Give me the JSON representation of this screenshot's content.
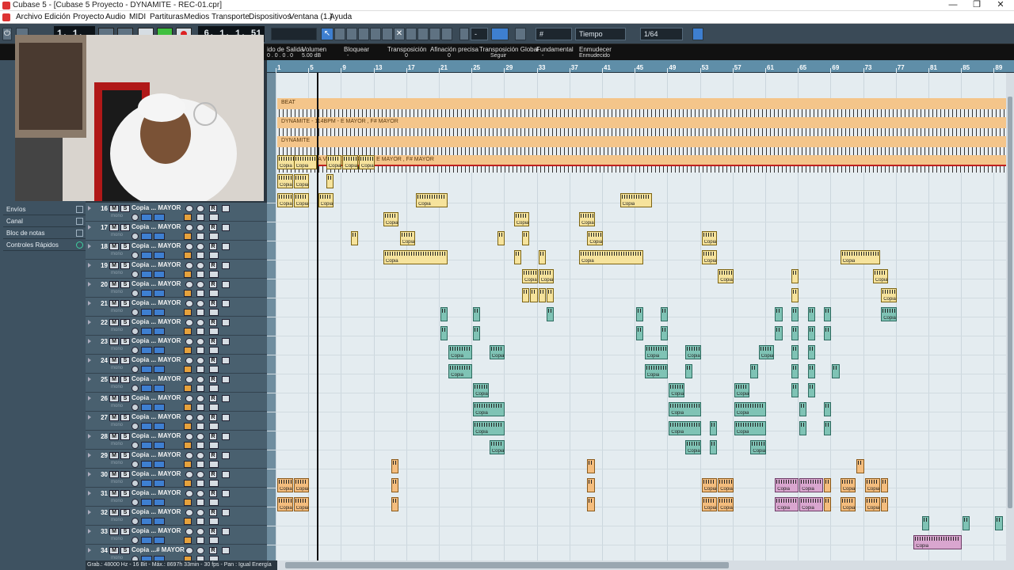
{
  "window": {
    "title": "Cubase 5 - [Cubase 5 Proyecto - DYNAMITE - REC-01.cpr]",
    "controls": [
      "—",
      "❐",
      "✕"
    ]
  },
  "menu": [
    "Archivo",
    "Edición",
    "Proyecto",
    "Audio",
    "MIDI",
    "Partituras",
    "Medios",
    "Transporte",
    "Dispositivos",
    "Ventana (1.)",
    "Ayuda"
  ],
  "toolbar": {
    "position_left": "1. 1. 1.  0",
    "position_right": "6. 1. 1. 51",
    "grid_label": "Tiempo",
    "quantize": "1/64",
    "dash": "-"
  },
  "infoline": {
    "items": [
      {
        "label": "ido de Salida",
        "value": "0 . 0 . 0 . 0"
      },
      {
        "label": "Volumen",
        "value": "5.00 dB"
      },
      {
        "label": "Bloquear",
        "value": "-"
      },
      {
        "label": "Transposición",
        "value": "0"
      },
      {
        "label": "Afinación precisa",
        "value": "0"
      },
      {
        "label": "Transposición Global",
        "value": "Seguir"
      },
      {
        "label": "Fundamental",
        "value": "-"
      },
      {
        "label": "Enmudecer",
        "value": "Enmudecido"
      }
    ]
  },
  "inspector": {
    "rows": [
      "Envíos",
      "Canal",
      "Bloc de notas",
      "Controles Rápidos"
    ]
  },
  "tracks": [
    {
      "num": "16",
      "name": "Copia ... MAYOR"
    },
    {
      "num": "17",
      "name": "Copia ... MAYOR"
    },
    {
      "num": "18",
      "name": "Copia ... MAYOR"
    },
    {
      "num": "19",
      "name": "Copia ... MAYOR"
    },
    {
      "num": "20",
      "name": "Copia ... MAYOR"
    },
    {
      "num": "21",
      "name": "Copia ... MAYOR"
    },
    {
      "num": "22",
      "name": "Copia ... MAYOR"
    },
    {
      "num": "23",
      "name": "Copia ... MAYOR"
    },
    {
      "num": "24",
      "name": "Copia ... MAYOR"
    },
    {
      "num": "25",
      "name": "Copia ... MAYOR"
    },
    {
      "num": "26",
      "name": "Copia ... MAYOR"
    },
    {
      "num": "27",
      "name": "Copia ... MAYOR"
    },
    {
      "num": "28",
      "name": "Copia ... MAYOR"
    },
    {
      "num": "29",
      "name": "Copia ... MAYOR"
    },
    {
      "num": "30",
      "name": "Copia ... MAYOR"
    },
    {
      "num": "31",
      "name": "Copia ... MAYOR"
    },
    {
      "num": "32",
      "name": "Copia ... MAYOR"
    },
    {
      "num": "33",
      "name": "Copia ... MAYOR"
    },
    {
      "num": "34",
      "name": "Copia ...# MAYOR"
    }
  ],
  "track_labels": {
    "mute": "M",
    "solo": "S",
    "read": "R",
    "mono": "mono",
    "edit": "e"
  },
  "ruler": [
    "1",
    "5",
    "9",
    "13",
    "17",
    "21",
    "25",
    "29",
    "33",
    "37",
    "41",
    "45",
    "49",
    "53",
    "57",
    "61",
    "65",
    "69",
    "73",
    "77",
    "81",
    "85",
    "89"
  ],
  "top_lanes": [
    {
      "label": "BEAT"
    },
    {
      "label": "DYNAMITE - 114BPM - E MAYOR , F# MAYOR"
    },
    {
      "label": "DYNAMITE"
    },
    {
      "label": "DYNAMITE - 1A VOXXXX - 114BPM - E MAYOR , F# MAYOR"
    }
  ],
  "event_label": "Copia",
  "statusbar": "Grab.: 48000 Hz - 16 Bit - Máx.: 8697h 33min - 30 fps - Pan : Igual Energía",
  "colors": {
    "audio_yellow": "#f6e39c",
    "audio_teal": "#7fc3b5",
    "audio_orange": "#f4bd7e",
    "audio_pink": "#d9a6cf",
    "ruler": "#5f8ea8"
  }
}
